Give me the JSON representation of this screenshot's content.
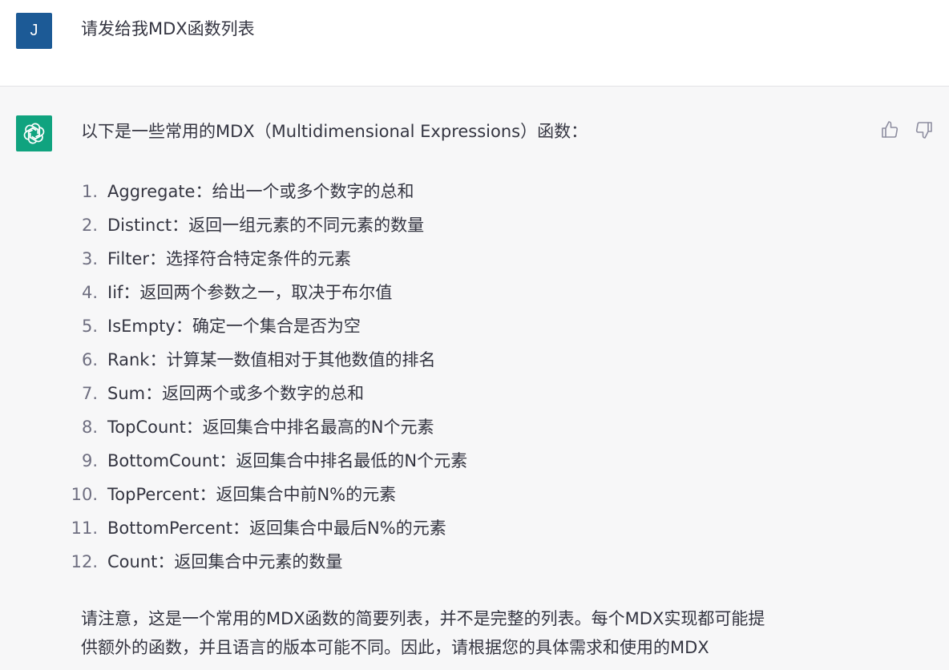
{
  "user": {
    "avatar_letter": "J",
    "message": "请发给我MDX函数列表"
  },
  "assistant": {
    "intro": "以下是一些常用的MDX（Multidimensional Expressions）函数：",
    "functions": [
      {
        "num": "1.",
        "text": "Aggregate：给出一个或多个数字的总和"
      },
      {
        "num": "2.",
        "text": "Distinct：返回一组元素的不同元素的数量"
      },
      {
        "num": "3.",
        "text": "Filter：选择符合特定条件的元素"
      },
      {
        "num": "4.",
        "text": "Iif：返回两个参数之一，取决于布尔值"
      },
      {
        "num": "5.",
        "text": "IsEmpty：确定一个集合是否为空"
      },
      {
        "num": "6.",
        "text": "Rank：计算某一数值相对于其他数值的排名"
      },
      {
        "num": "7.",
        "text": "Sum：返回两个或多个数字的总和"
      },
      {
        "num": "8.",
        "text": "TopCount：返回集合中排名最高的N个元素"
      },
      {
        "num": "9.",
        "text": "BottomCount：返回集合中排名最低的N个元素"
      },
      {
        "num": "10.",
        "text": "TopPercent：返回集合中前N%的元素"
      },
      {
        "num": "11.",
        "text": "BottomPercent：返回集合中最后N%的元素"
      },
      {
        "num": "12.",
        "text": "Count：返回集合中元素的数量"
      }
    ],
    "note_lines": [
      "请注意，这是一个常用的MDX函数的简要列表，并不是完整的列表。每个MDX实现都可能提",
      "供额外的函数，并且语言的版本可能不同。因此，请根据您的具体需求和使用的MDX"
    ]
  },
  "icons": {
    "assistant_avatar": "openai-logo-icon",
    "thumbs_up": "thumbs-up-icon",
    "thumbs_down": "thumbs-down-icon"
  },
  "colors": {
    "user_avatar_bg": "#1c5a96",
    "assistant_avatar_bg": "#10a37f",
    "assistant_row_bg": "#f7f7f8"
  }
}
